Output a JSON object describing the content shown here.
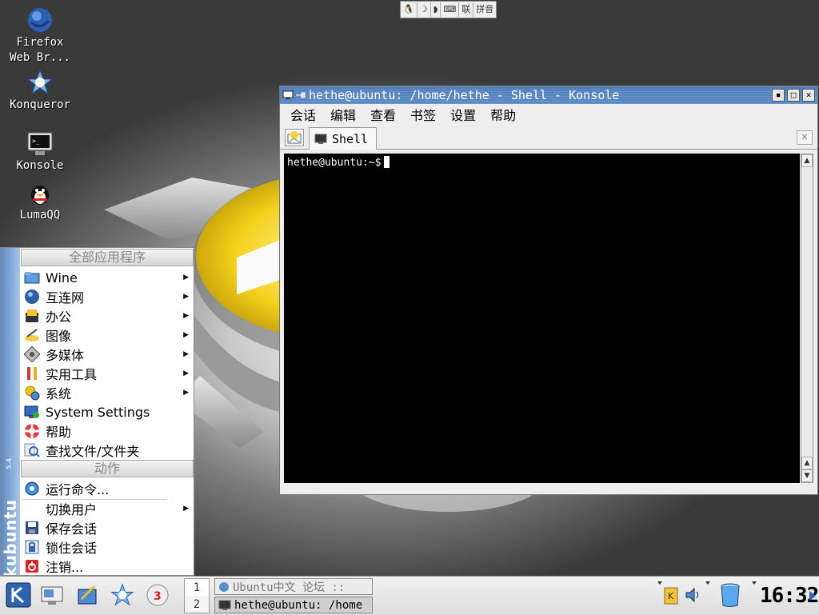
{
  "desktop_icons": [
    {
      "label_line1": "Firefox",
      "label_line2": "Web Br...",
      "icon": "firefox-globe-icon"
    },
    {
      "label_line1": "Konqueror",
      "label_line2": "",
      "icon": "konqueror-icon"
    },
    {
      "label_line1": "Konsole",
      "label_line2": "",
      "icon": "konsole-monitor-icon"
    },
    {
      "label_line1": "LumaQQ",
      "label_line2": "",
      "icon": "lumaqq-penguin-icon"
    }
  ],
  "ime_bar": {
    "items": [
      "tux-icon",
      "fullwidth-icon",
      "punct-icon",
      "softkbd-icon"
    ],
    "cn_label": "联",
    "mode": "拼音"
  },
  "konsole": {
    "title": "hethe@ubuntu: /home/hethe - Shell - Konsole",
    "menu": [
      "会话",
      "编辑",
      "查看",
      "书签",
      "设置",
      "帮助"
    ],
    "tab_label": "Shell",
    "prompt": "hethe@ubuntu:~$"
  },
  "kmenu": {
    "side_brand": "kubuntu",
    "side_version": "5.4",
    "header_all_apps": "全部应用程序",
    "apps": [
      {
        "label": "Wine",
        "icon": "wine-folder-icon",
        "submenu": true
      },
      {
        "label": "互连网",
        "icon": "internet-globe-icon",
        "submenu": true
      },
      {
        "label": "办公",
        "icon": "office-icon",
        "submenu": true
      },
      {
        "label": "图像",
        "icon": "graphics-icon",
        "submenu": true
      },
      {
        "label": "多媒体",
        "icon": "multimedia-icon",
        "submenu": true
      },
      {
        "label": "实用工具",
        "icon": "utilities-icon",
        "submenu": true
      },
      {
        "label": "系统",
        "icon": "system-gears-icon",
        "submenu": true
      },
      {
        "label": "System Settings",
        "icon": "system-settings-icon",
        "submenu": false
      },
      {
        "label": "帮助",
        "icon": "help-lifebuoy-icon",
        "submenu": false
      },
      {
        "label": "查找文件/文件夹",
        "icon": "find-files-icon",
        "submenu": false
      }
    ],
    "header_actions": "动作",
    "actions": [
      {
        "label": "运行命令...",
        "icon": "run-command-icon",
        "submenu": false
      },
      {
        "label": "切换用户",
        "icon": "",
        "submenu": true
      },
      {
        "label": "保存会话",
        "icon": "save-session-icon",
        "submenu": false
      },
      {
        "label": "锁住会话",
        "icon": "lock-session-icon",
        "submenu": false
      },
      {
        "label": "注销...",
        "icon": "logout-icon",
        "submenu": false
      }
    ]
  },
  "taskbar": {
    "pager": [
      "1",
      "2"
    ],
    "tasks": [
      {
        "label": "Ubuntu中文 论坛 ::",
        "icon": "konqueror-task-icon",
        "active": false
      },
      {
        "label": "hethe@ubuntu: /home",
        "icon": "konsole-task-icon",
        "active": true
      }
    ],
    "clock": "16:32"
  },
  "colors": {
    "accent": "#4d7cb8",
    "terminal_bg": "#000000",
    "terminal_fg": "#ffffff"
  }
}
